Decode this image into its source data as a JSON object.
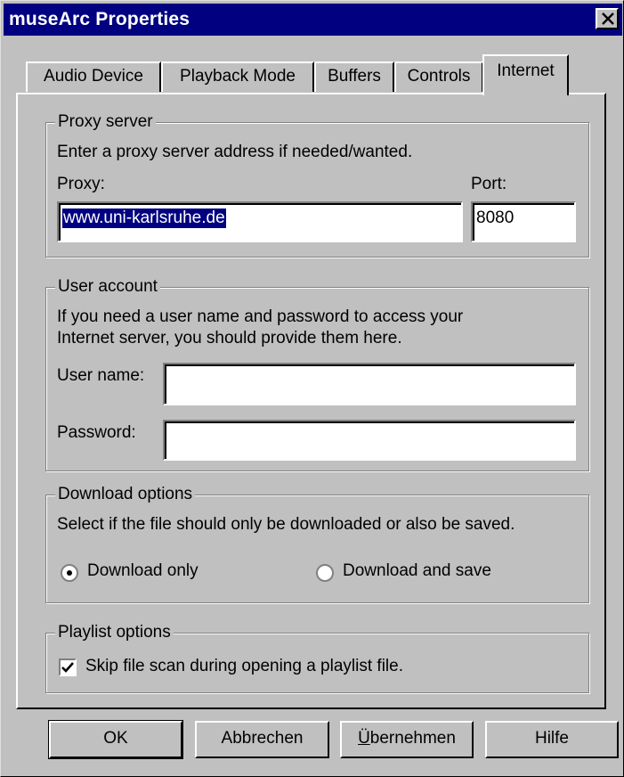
{
  "window": {
    "title": "museArc Properties"
  },
  "tabs": [
    {
      "label": "Audio Device"
    },
    {
      "label": "Playback Mode"
    },
    {
      "label": "Buffers"
    },
    {
      "label": "Controls"
    },
    {
      "label": "Internet",
      "active": true
    }
  ],
  "proxy": {
    "group_title": "Proxy server",
    "description": "Enter a proxy server address if needed/wanted.",
    "proxy_label": "Proxy:",
    "proxy_value": "www.uni-karlsruhe.de",
    "port_label": "Port:",
    "port_value": "8080"
  },
  "account": {
    "group_title": "User account",
    "description_line1": "If you need a user name and password to access your",
    "description_line2": "Internet server, you should provide them here.",
    "username_label": "User name:",
    "username_value": "",
    "password_label": "Password:",
    "password_value": ""
  },
  "download": {
    "group_title": "Download options",
    "description": "Select if the file should only be downloaded or also be saved.",
    "option_download_only": "Download only",
    "option_download_save": "Download and save",
    "selected": "Download only"
  },
  "playlist": {
    "group_title": "Playlist options",
    "skip_scan_label": "Skip file scan during opening a playlist file.",
    "skip_scan_checked": true
  },
  "buttons": {
    "ok": "OK",
    "cancel": "Abbrechen",
    "apply_prefix": "Ü",
    "apply_rest": "bernehmen",
    "help": "Hilfe"
  }
}
